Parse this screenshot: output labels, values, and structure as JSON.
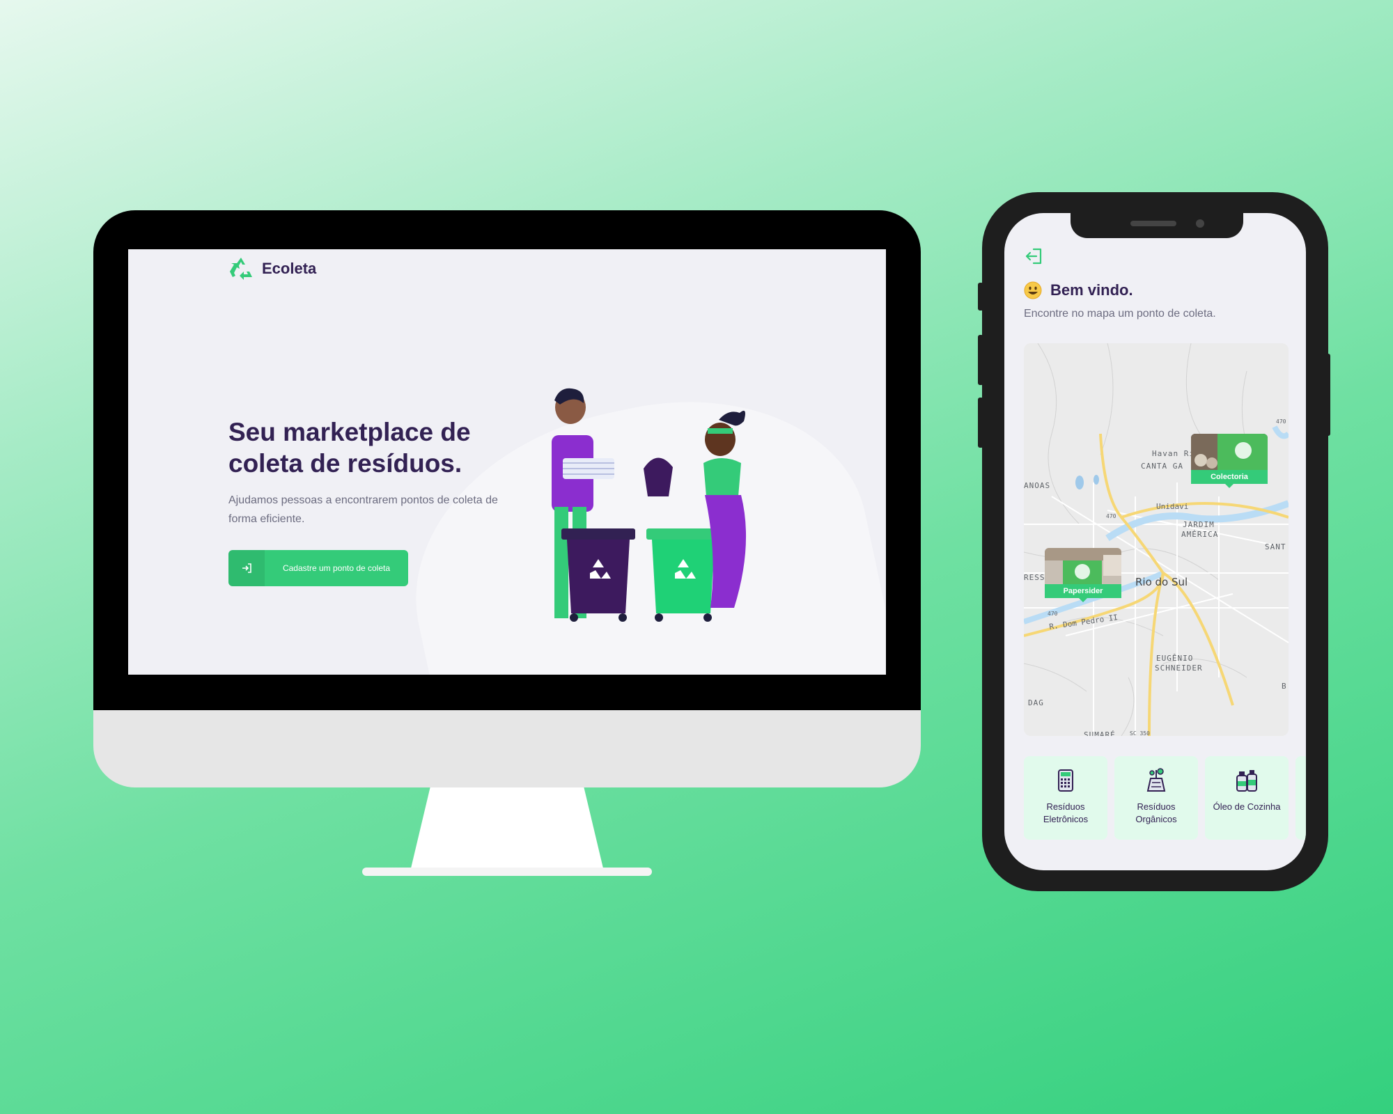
{
  "desktop": {
    "logo_text": "Ecoleta",
    "hero_title": "Seu marketplace de coleta de resíduos.",
    "hero_description": "Ajudamos pessoas a encontrarem pontos de coleta de forma eficiente.",
    "cta_label": "Cadastre um ponto de coleta"
  },
  "mobile": {
    "welcome_title": "Bem vindo.",
    "welcome_subtitle": "Encontre no mapa um ponto de coleta.",
    "map": {
      "labels": [
        "Havan Ri",
        "CANTA GA",
        "ANOAS",
        "Unidavi",
        "JARDIM",
        "AMÉRICA",
        "SANT",
        "RESS",
        "Rio do Sul",
        "R. Dom Pedro II",
        "EUGÊNIO",
        "SCHNEIDER",
        "DAG",
        "SUMARÉ",
        "B"
      ],
      "road_shields": [
        "470",
        "470",
        "470",
        "SC 350"
      ],
      "markers": [
        {
          "name": "Colectoria"
        },
        {
          "name": "Papersider"
        }
      ]
    },
    "items": [
      {
        "label": "Resíduos Eletrônicos",
        "icon": "battery-icon"
      },
      {
        "label": "Resíduos Orgânicos",
        "icon": "compost-icon"
      },
      {
        "label": "Óleo de Cozinha",
        "icon": "oil-bottle-icon"
      }
    ]
  },
  "colors": {
    "primary": "#34cb79",
    "title": "#322153",
    "text": "#6c6c80",
    "background": "#f0f0f5"
  }
}
